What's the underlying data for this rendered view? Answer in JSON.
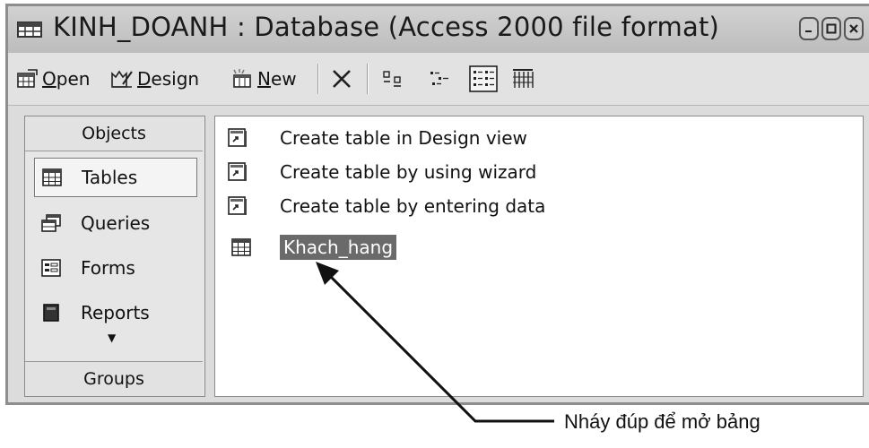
{
  "window": {
    "title": "KINH_DOANH : Database (Access 2000 file format)",
    "app_icon": "database-window-icon",
    "controls": [
      "minimize",
      "maximize",
      "close"
    ]
  },
  "toolbar": {
    "open_accel": "O",
    "open_rest": "pen",
    "design_accel": "D",
    "design_rest": "esign",
    "new_accel": "N",
    "new_rest": "ew",
    "icons": [
      "open-icon",
      "design-icon",
      "new-icon",
      "delete-icon",
      "large-icons-icon",
      "small-icons-icon",
      "list-view-icon",
      "details-view-icon"
    ]
  },
  "objects": {
    "header": "Objects",
    "items": [
      {
        "label": "Tables",
        "icon": "table-icon",
        "active": true
      },
      {
        "label": "Queries",
        "icon": "query-icon",
        "active": false
      },
      {
        "label": "Forms",
        "icon": "form-icon",
        "active": false
      },
      {
        "label": "Reports",
        "icon": "report-icon",
        "active": false
      }
    ],
    "groups_header": "Groups"
  },
  "list": {
    "items": [
      {
        "label": "Create table in Design view",
        "icon": "shortcut-icon"
      },
      {
        "label": "Create table by using wizard",
        "icon": "shortcut-icon"
      },
      {
        "label": "Create table by entering data",
        "icon": "shortcut-icon"
      },
      {
        "label": "Khach_hang",
        "icon": "table-icon",
        "selected": true
      }
    ]
  },
  "annotation": {
    "text": "Nháy đúp để mở bảng"
  },
  "colors": {
    "window_bg": "#dcdcdc",
    "selection": "#6a6a6a",
    "list_bg": "#ffffff"
  }
}
